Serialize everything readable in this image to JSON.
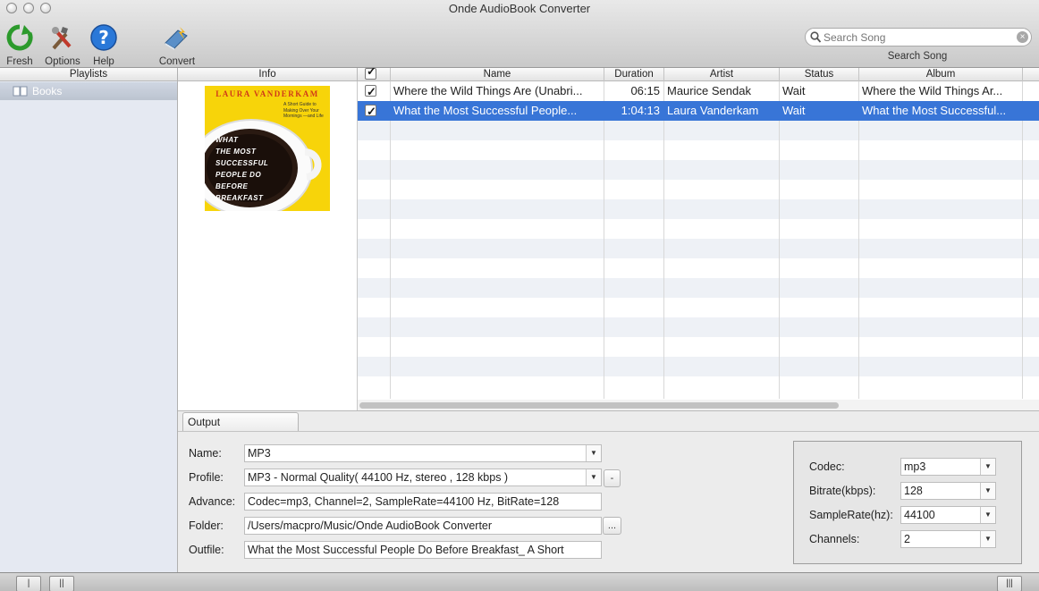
{
  "window": {
    "title": "Onde AudioBook Converter"
  },
  "toolbar": {
    "fresh": "Fresh",
    "options": "Options",
    "help": "Help",
    "convert": "Convert"
  },
  "search": {
    "placeholder": "Search Song",
    "caption": "Search Song"
  },
  "panels": {
    "playlists": "Playlists",
    "info": "Info"
  },
  "playlists": {
    "items": [
      {
        "label": "Books",
        "icon": "book-icon"
      }
    ]
  },
  "cover": {
    "author": "LAURA VANDERKAM",
    "tagline": "A Short Guide to Making Over Your Mornings —and Life",
    "title_lines": [
      "WHAT",
      "THE MOST",
      "SUCCESSFUL",
      "PEOPLE DO",
      "BEFORE",
      "BREAKFAST"
    ]
  },
  "table": {
    "columns": [
      "Name",
      "Duration",
      "Artist",
      "Status",
      "Album"
    ],
    "rows": [
      {
        "checked": true,
        "name": "Where the Wild Things Are (Unabri...",
        "duration": "06:15",
        "artist": "Maurice Sendak",
        "status": "Wait",
        "album": "Where the Wild Things Ar..."
      },
      {
        "checked": true,
        "name": "What the Most Successful People...",
        "duration": "1:04:13",
        "artist": "Laura Vanderkam",
        "status": "Wait",
        "album": "What the Most Successful..."
      }
    ]
  },
  "output": {
    "tab": "Output",
    "name_label": "Name:",
    "name_value": "MP3",
    "profile_label": "Profile:",
    "profile_value": "MP3 - Normal Quality( 44100 Hz, stereo , 128 kbps )",
    "profile_minus": "-",
    "advance_label": "Advance:",
    "advance_value": "Codec=mp3, Channel=2, SampleRate=44100 Hz, BitRate=128",
    "folder_label": "Folder:",
    "folder_value": "/Users/macpro/Music/Onde AudioBook Converter",
    "browse": "...",
    "outfile_label": "Outfile:",
    "outfile_value": "What the Most Successful People Do Before Breakfast_ A Short"
  },
  "codec": {
    "codec_label": "Codec:",
    "codec_value": "mp3",
    "bitrate_label": "Bitrate(kbps):",
    "bitrate_value": "128",
    "samplerate_label": "SampleRate(hz):",
    "samplerate_value": "44100",
    "channels_label": "Channels:",
    "channels_value": "2"
  },
  "colors": {
    "selection": "#3875d7",
    "cover_yellow": "#f7d40a"
  }
}
